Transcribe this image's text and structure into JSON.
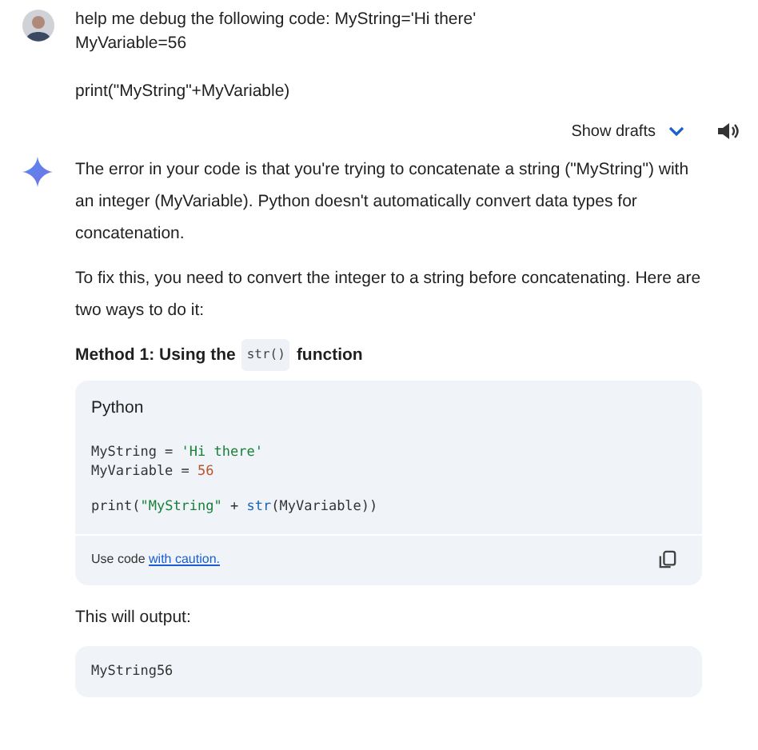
{
  "prompt": {
    "paragraphs": [
      [
        "help me debug the following code: MyString='Hi there'",
        "MyVariable=56"
      ],
      [
        "print(\"MyString\"+MyVariable)"
      ]
    ]
  },
  "drafts": {
    "label": "Show drafts",
    "expanded": false
  },
  "response": {
    "blocks": [
      {
        "kind": "paragraph",
        "text": "The error in your code is that you're trying to concatenate a string (\"MyString\") with an integer (MyVariable). Python doesn't automatically convert data types for concatenation."
      },
      {
        "kind": "paragraph",
        "text": "To fix this, you need to convert the integer to a string before concatenating. Here are two ways to do it:"
      },
      {
        "kind": "heading",
        "parts": [
          {
            "kind": "text",
            "text": "Method 1: Using the"
          },
          {
            "kind": "code",
            "text": "str()"
          },
          {
            "kind": "text",
            "text": "function"
          }
        ]
      },
      {
        "kind": "codeblock",
        "language": "Python",
        "groups": [
          [
            [
              {
                "kind": "plain",
                "text": "MyString = "
              },
              {
                "kind": "string",
                "text": "'Hi there'"
              }
            ],
            [
              {
                "kind": "plain",
                "text": "MyVariable = "
              },
              {
                "kind": "number",
                "text": "56"
              }
            ]
          ],
          [
            [
              {
                "kind": "plain",
                "text": "print("
              },
              {
                "kind": "string",
                "text": "\"MyString\""
              },
              {
                "kind": "plain",
                "text": " + "
              },
              {
                "kind": "builtin",
                "text": "str"
              },
              {
                "kind": "plain",
                "text": "(MyVariable))"
              }
            ]
          ]
        ],
        "footer": {
          "text": "Use code",
          "link": "with caution."
        }
      },
      {
        "kind": "paragraph",
        "text": "This will output:"
      },
      {
        "kind": "output",
        "text": "MyString56"
      }
    ]
  }
}
